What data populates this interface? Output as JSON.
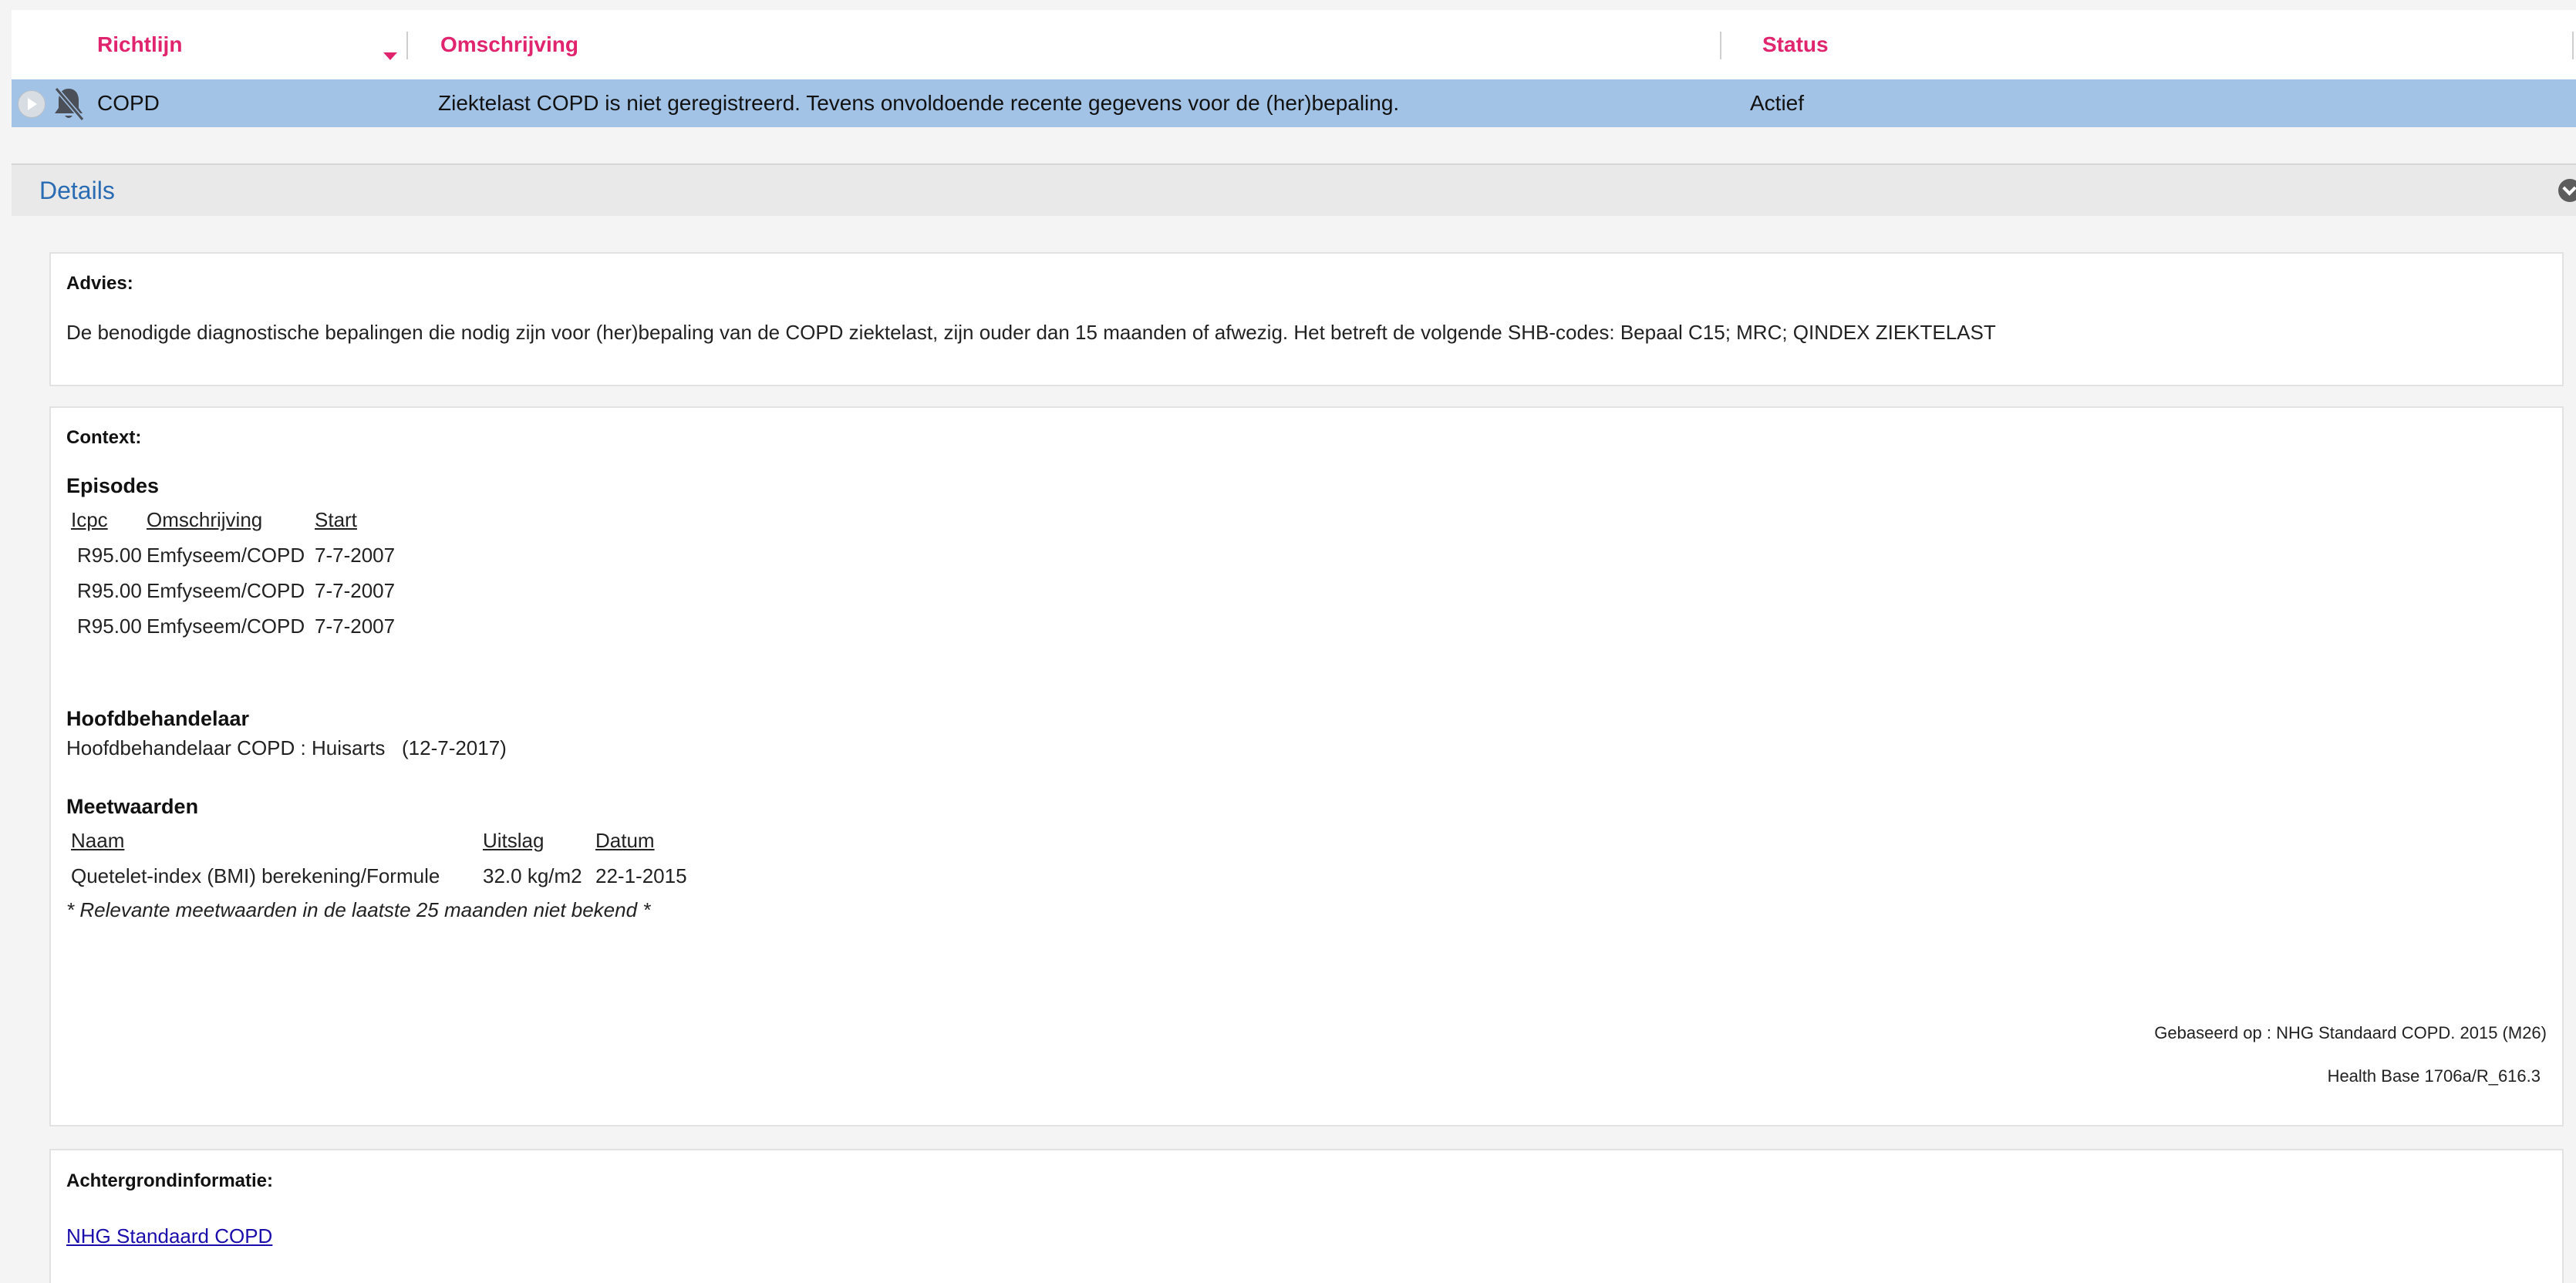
{
  "grid": {
    "columns": {
      "richtlijn": "Richtlijn",
      "omschrijving": "Omschrijving",
      "status": "Status"
    },
    "rows": [
      {
        "richtlijn": "COPD",
        "omschrijving": "Ziektelast COPD is niet geregistreerd. Tevens onvoldoende recente gegevens voor de (her)bepaling.",
        "status": "Actief"
      }
    ]
  },
  "details": {
    "title": "Details"
  },
  "advies": {
    "heading": "Advies:",
    "text": "De benodigde diagnostische bepalingen die nodig zijn voor (her)bepaling van de COPD ziektelast, zijn ouder dan 15 maanden of afwezig. Het betreft de volgende SHB-codes: Bepaal C15; MRC; QINDEX ZIEKTELAST"
  },
  "context": {
    "heading": "Context:",
    "episodes": {
      "title": "Episodes",
      "columns": [
        "Icpc",
        "Omschrijving",
        "Start"
      ],
      "rows": [
        [
          "R95.00",
          "Emfyseem/COPD",
          "7-7-2007"
        ],
        [
          "R95.00",
          "Emfyseem/COPD",
          "7-7-2007"
        ],
        [
          "R95.00",
          "Emfyseem/COPD",
          "7-7-2007"
        ]
      ]
    },
    "hoofdbehandelaar": {
      "title": "Hoofdbehandelaar",
      "text": "Hoofdbehandelaar COPD : Huisarts   (12-7-2017)"
    },
    "meetwaarden": {
      "title": "Meetwaarden",
      "columns": [
        "Naam",
        "Uitslag",
        "Datum"
      ],
      "rows": [
        [
          "Quetelet-index (BMI) berekening/Formule",
          "32.0 kg/m2",
          "22-1-2015"
        ]
      ],
      "note": "* Relevante meetwaarden in de laatste 25 maanden niet bekend *"
    },
    "based_on": "Gebaseerd op : NHG Standaard COPD. 2015 (M26)",
    "version": "Health Base 1706a/R_616.3"
  },
  "achtergrond": {
    "heading": "Achtergrondinformatie:",
    "link": "NHG Standaard COPD"
  },
  "icons": {
    "play": "play-circle-icon",
    "bell": "bell-muted-icon",
    "collapse": "chevron-circle-down-icon",
    "sort": "sort-down-icon"
  },
  "colors": {
    "header_text": "#e0246e",
    "selected_row": "#a3c3e6",
    "details_title": "#2a6cb3",
    "link": "#1a0dab"
  }
}
